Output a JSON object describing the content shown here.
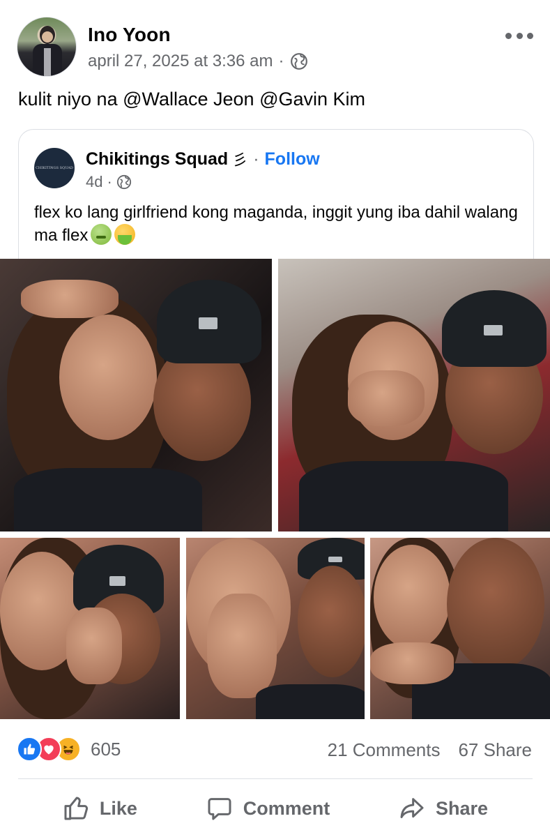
{
  "post": {
    "author": "Ino Yoon",
    "timestamp": "april 27, 2025 at 3:36 am",
    "meta_separator": "·",
    "privacy_icon": "globe-icon",
    "text": "kulit niyo na @Wallace Jeon @Gavin Kim"
  },
  "shared": {
    "page_name": "Chikitings Squad",
    "page_mark": "彡",
    "separator": "·",
    "follow_label": "Follow",
    "age": "4d",
    "separator_meta": "·",
    "text": "flex ko lang girlfriend kong maganda, inggit yung iba dahil walang ma flex",
    "emojis": [
      "nauseated-face",
      "face-vomiting"
    ],
    "avatar_text": "CHIKITINGS SQUAD"
  },
  "engagement": {
    "reaction_icons": [
      "like-icon",
      "love-icon",
      "haha-icon"
    ],
    "reaction_count": "605",
    "comments": "21 Comments",
    "shares": "67 Share"
  },
  "actions": {
    "like_label": "Like",
    "comment_label": "Comment",
    "share_label": "Share"
  },
  "colors": {
    "brand_blue": "#1877f2",
    "secondary_text": "#65676b",
    "love_red": "#f33e58",
    "haha_yellow": "#f7b125"
  }
}
